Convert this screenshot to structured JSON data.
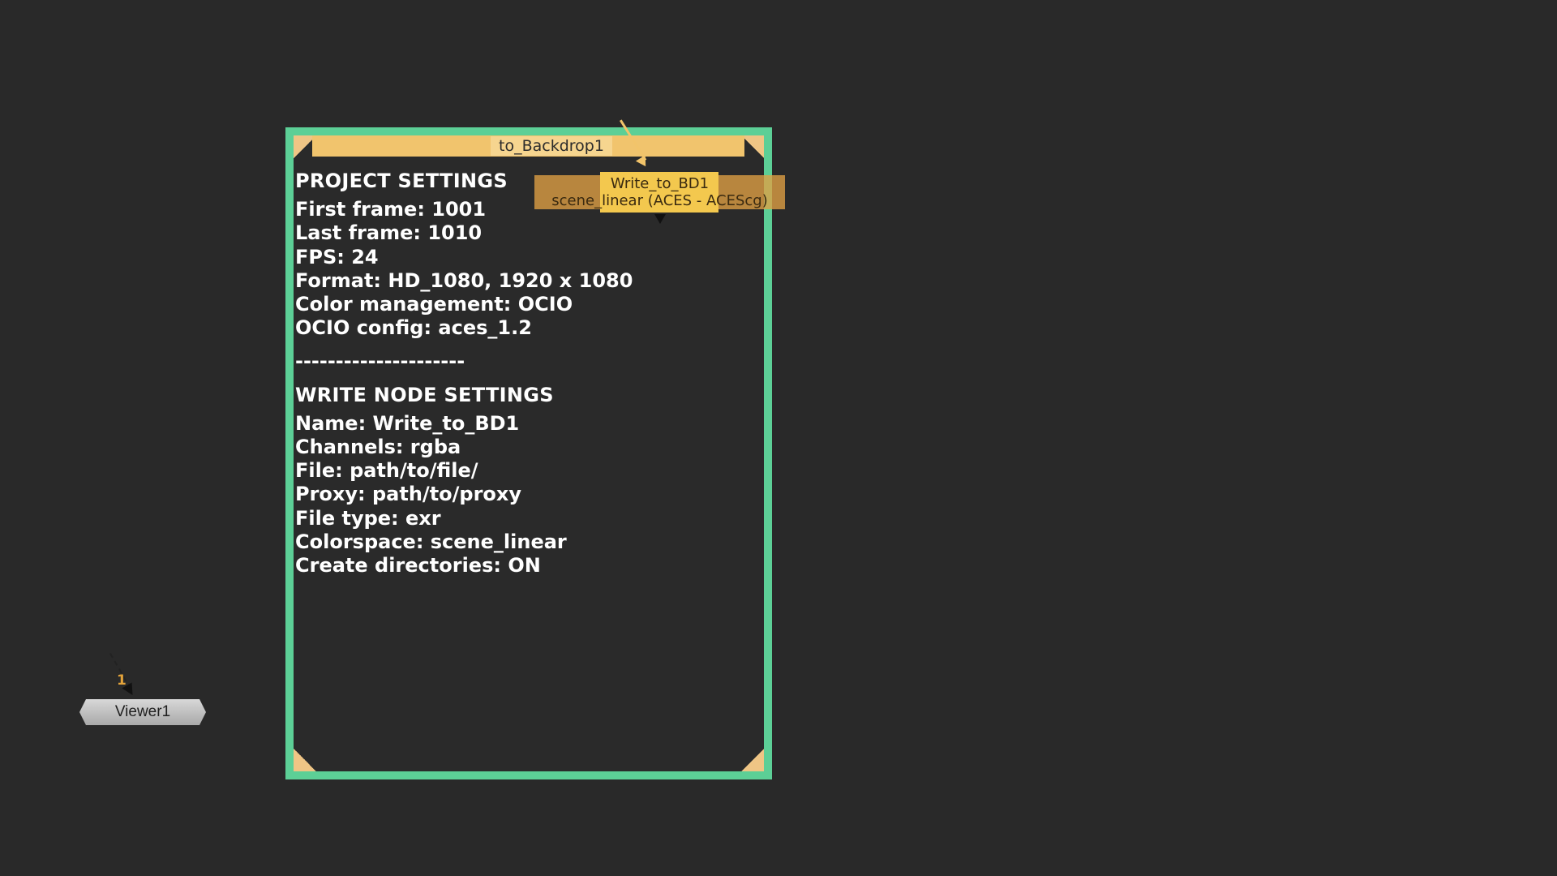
{
  "backdrop": {
    "label": "to_Backdrop1",
    "border_color": "#5ccf96",
    "title_color": "#f1c46d",
    "project_heading": "PROJECT SETTINGS",
    "project_lines": [
      "First frame: 1001",
      "Last frame: 1010",
      "FPS: 24",
      "Format: HD_1080, 1920 x 1080",
      "Color management: OCIO",
      "OCIO config: aces_1.2"
    ],
    "separator": "---------------------",
    "write_heading": "WRITE NODE SETTINGS",
    "write_lines": [
      "Name: Write_to_BD1",
      "Channels: rgba",
      "File: path/to/file/",
      "Proxy: path/to/proxy",
      "File type: exr",
      "Colorspace: scene_linear",
      "Create directories: ON"
    ]
  },
  "write_node": {
    "name": "Write_to_BD1",
    "colorspace": "scene_linear (ACES - ACEScg)",
    "color": "#f3c84e"
  },
  "viewer_node": {
    "name": "Viewer1",
    "input_number": "1"
  }
}
